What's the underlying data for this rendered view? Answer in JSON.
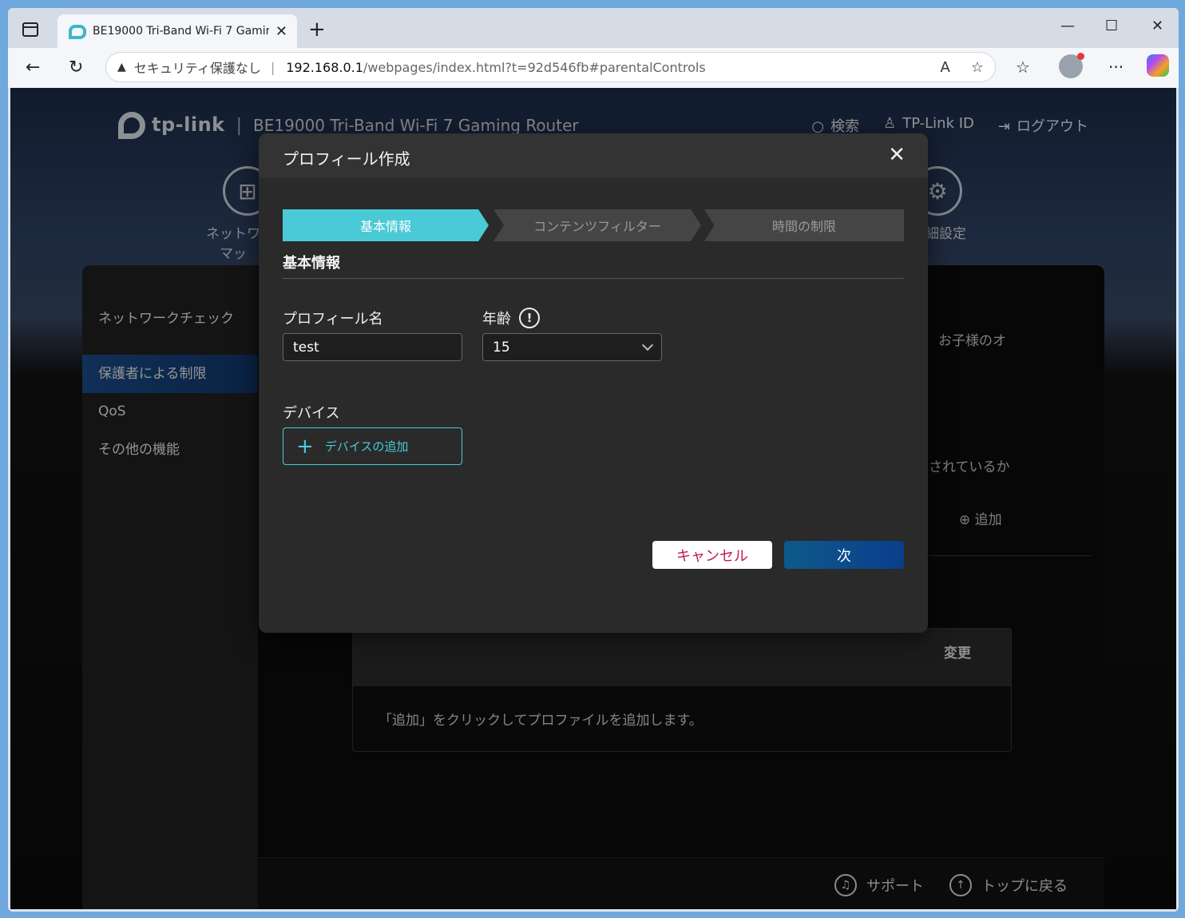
{
  "browser": {
    "tab_title": "BE19000 Tri-Band Wi-Fi 7 Gaming",
    "security_text": "セキュリティ保護なし",
    "url_host": "192.168.0.1",
    "url_path": "/webpages/index.html?t=92d546fb#parentalControls"
  },
  "router": {
    "model": "BE19000 Tri-Band Wi-Fi 7 Gaming Router",
    "top_links": {
      "search": "検索",
      "tplink_id": "TP-Link ID",
      "logout": "ログアウト"
    },
    "nav_left_label_1": "ネットワ",
    "nav_left_label_2": "マッ",
    "nav_right_label": "細設定",
    "sidebar": [
      "ネットワークチェック",
      "保護者による制限",
      "QoS",
      "その他の機能"
    ],
    "bg_text_1": "お子様のオ",
    "bg_text_2": "されているか",
    "bg_add": "追加",
    "bg_table_header": "変更",
    "bg_table_empty": "「追加」をクリックしてプロファイルを追加します。",
    "footer": {
      "support": "サポート",
      "top": "トップに戻る"
    }
  },
  "modal": {
    "title": "プロフィール作成",
    "steps": [
      "基本情報",
      "コンテンツフィルター",
      "時間の制限"
    ],
    "section_title": "基本情報",
    "profile_name_label": "プロフィール名",
    "profile_name_value": "test",
    "age_label": "年齢",
    "age_value": "15",
    "device_label": "デバイス",
    "add_device": "デバイスの追加",
    "cancel": "キャンセル",
    "next": "次"
  }
}
